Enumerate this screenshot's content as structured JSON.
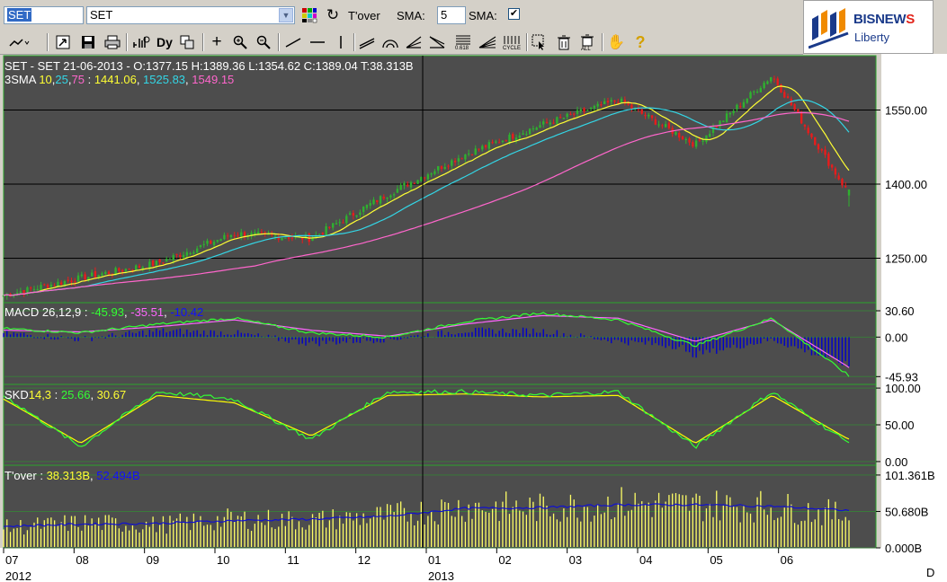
{
  "toolbar": {
    "symbol_input": "SET",
    "symbol_select": "SET",
    "tover_label": "T'over",
    "sma1_label": "SMA:",
    "sma1_value": "5",
    "sma2_label": "SMA:",
    "sma2_checked": true,
    "dy_label": "Dy"
  },
  "logo": {
    "brand_main": "BISNEW",
    "brand_accent": "S",
    "brand_sub": "Liberty"
  },
  "colors": {
    "panel_bg": "#4d4d4d",
    "candle_up": "#2fb12f",
    "candle_down": "#e81c1c",
    "sma10": "#ffff33",
    "sma25": "#33d6e6",
    "sma75": "#ff66cc",
    "macd": "#33ff33",
    "signal": "#ff66ff",
    "hist": "#0000cc",
    "k": "#33ff33",
    "d": "#ffff00",
    "vol": "#ffff66",
    "vol_avg": "#1010d0"
  },
  "chart_data": [
    {
      "type": "candlestick",
      "title": "SET - SET 21-06-2013 - O:1377.15 H:1389.36 L:1354.62 C:1389.04 T:38.313B",
      "ohlc": {
        "open": 1377.15,
        "high": 1389.36,
        "low": 1354.62,
        "close": 1389.04,
        "turnover": "38.313B"
      },
      "indicator_label": "3SMA",
      "sma_periods": [
        "10",
        "25",
        "75"
      ],
      "sma_values": [
        "1441.06",
        "1525.83",
        "1549.15"
      ],
      "ylim": [
        1160,
        1660
      ],
      "yticks": [
        "1550.00",
        "1400.00",
        "1250.00"
      ],
      "ytick_values": [
        1550,
        1400,
        1250
      ],
      "x": [
        "2012-07",
        "2012-08",
        "2012-09",
        "2012-10",
        "2012-11",
        "2012-12",
        "2013-01",
        "2013-02",
        "2013-03",
        "2013-04",
        "2013-05",
        "2013-06"
      ],
      "close": [
        1175,
        1210,
        1240,
        1300,
        1290,
        1380,
        1460,
        1520,
        1570,
        1480,
        1620,
        1380
      ]
    },
    {
      "type": "line",
      "name": "MACD",
      "params": "26,12,9",
      "values": [
        "-45.93",
        "-35.51",
        "-10.42"
      ],
      "ylim": [
        -55,
        40
      ],
      "yticks": [
        "30.60",
        "0.00",
        "-45.93"
      ],
      "ytick_values": [
        30.6,
        0,
        -45.93
      ],
      "macd": [
        10,
        5,
        15,
        22,
        5,
        0,
        18,
        28,
        20,
        -10,
        22,
        -45
      ],
      "signal": [
        8,
        6,
        12,
        20,
        8,
        1,
        15,
        25,
        22,
        -5,
        20,
        -35
      ]
    },
    {
      "type": "line",
      "name": "SKD",
      "params": "14,3",
      "values": [
        "25.66",
        "30.67"
      ],
      "ylim": [
        -5,
        105
      ],
      "yticks": [
        "100.00",
        "50.00",
        "0.00"
      ],
      "ytick_values": [
        100,
        50,
        0
      ],
      "k": [
        90,
        20,
        95,
        85,
        30,
        95,
        95,
        90,
        95,
        20,
        95,
        25
      ],
      "d": [
        85,
        25,
        90,
        80,
        35,
        90,
        92,
        88,
        90,
        25,
        90,
        30
      ]
    },
    {
      "type": "bar",
      "name": "T'over",
      "values": [
        "38.313B",
        "52.494B"
      ],
      "ylim": [
        0,
        115
      ],
      "yticks": [
        "101.361B",
        "50.680B",
        "0.000B"
      ],
      "ytick_values": [
        101.361,
        50.68,
        0
      ],
      "volume": [
        28,
        35,
        32,
        40,
        38,
        45,
        58,
        55,
        62,
        60,
        58,
        45
      ],
      "volume_avg": [
        30,
        33,
        34,
        38,
        40,
        44,
        55,
        56,
        60,
        60,
        58,
        52
      ]
    }
  ],
  "x_axis": {
    "months": [
      "07",
      "08",
      "09",
      "10",
      "11",
      "12",
      "01",
      "02",
      "03",
      "04",
      "05",
      "06"
    ],
    "years": [
      {
        "label": "2012",
        "month_index": 0
      },
      {
        "label": "2013",
        "month_index": 6
      }
    ],
    "period": "D"
  }
}
